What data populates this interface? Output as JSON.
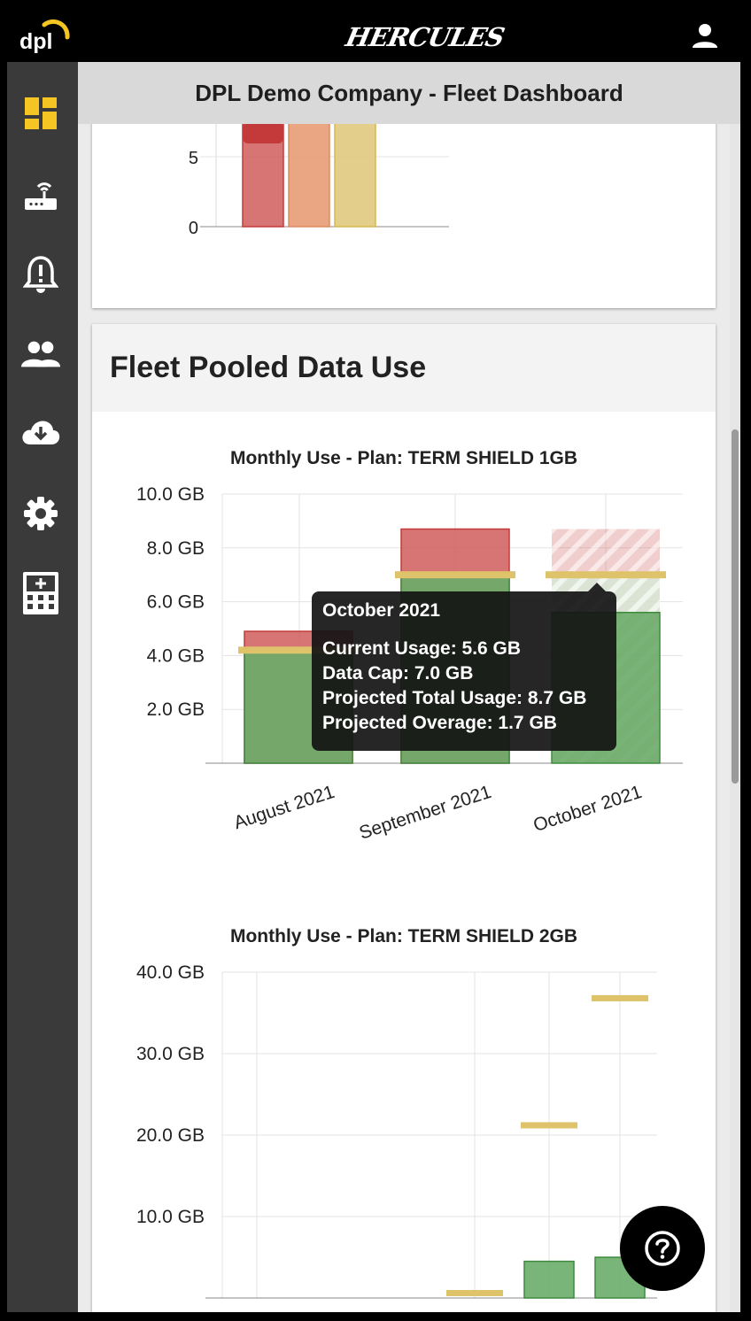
{
  "app": {
    "logo_text": "dpl",
    "brand_name": "HERCULES"
  },
  "header": {
    "title": "DPL Demo Company - Fleet Dashboard",
    "user_icon": "account-icon"
  },
  "sidebar": {
    "items": [
      {
        "name": "dashboard",
        "icon": "dashboard-icon",
        "active": true
      },
      {
        "name": "devices",
        "icon": "router-icon",
        "active": false
      },
      {
        "name": "alerts",
        "icon": "alert-bell-icon",
        "active": false
      },
      {
        "name": "users",
        "icon": "people-icon",
        "active": false
      },
      {
        "name": "downloads",
        "icon": "cloud-download-icon",
        "active": false
      },
      {
        "name": "settings",
        "icon": "gear-icon",
        "active": false
      },
      {
        "name": "calculator",
        "icon": "calculator-icon",
        "active": false
      }
    ]
  },
  "colors": {
    "accent": "#f5c524",
    "bar_red": "#d05c5c",
    "bar_orange": "#e89c76",
    "bar_yellow": "#e0c97e",
    "bar_green": "#6aad6a",
    "cap_line": "#dec36a"
  },
  "top_chart": {
    "y_ticks": [
      "5",
      "0"
    ]
  },
  "pool_section": {
    "title": "Fleet Pooled Data Use"
  },
  "chart_data": [
    {
      "type": "bar",
      "title": "Monthly Use - Plan: TERM SHIELD 1GB",
      "categories": [
        "August 2021",
        "September 2021",
        "October 2021"
      ],
      "y_ticks": [
        "10.0 GB",
        "8.0 GB",
        "6.0 GB",
        "4.0 GB",
        "2.0 GB"
      ],
      "ylim": [
        0,
        10
      ],
      "series": [
        {
          "name": "Current Usage",
          "values": [
            4.1,
            7.0,
            5.6
          ]
        },
        {
          "name": "Projected Overage",
          "values": [
            0.8,
            1.7,
            1.7
          ]
        },
        {
          "name": "Data Cap",
          "values": [
            4.2,
            7.0,
            7.0
          ]
        }
      ],
      "projected_total": [
        4.9,
        8.7,
        8.7
      ],
      "tooltip": {
        "title": "October 2021",
        "lines": [
          "Current Usage: 5.6 GB",
          "Data Cap: 7.0 GB",
          "Projected Total Usage: 8.7 GB",
          "Projected Overage: 1.7 GB"
        ]
      }
    },
    {
      "type": "bar",
      "title": "Monthly Use - Plan: TERM SHIELD 2GB",
      "categories": [
        "",
        "",
        "",
        ""
      ],
      "y_ticks": [
        "40.0 GB",
        "30.0 GB",
        "20.0 GB",
        "10.0 GB"
      ],
      "ylim": [
        0,
        40
      ],
      "series": [
        {
          "name": "Current Usage",
          "values": [
            0,
            0,
            4.5,
            5.0
          ]
        },
        {
          "name": "Data Cap",
          "values": [
            null,
            0.6,
            21.2,
            36.8
          ]
        }
      ]
    }
  ]
}
